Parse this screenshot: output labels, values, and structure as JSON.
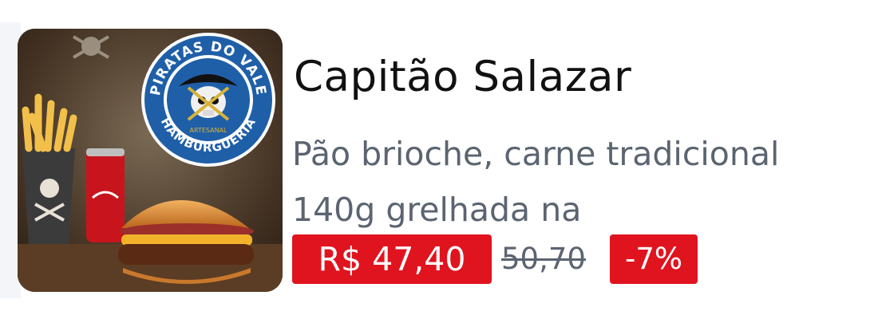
{
  "product": {
    "name": "Capitão Salazar",
    "description": "Pão brioche, carne tradicional 140g grelhada na",
    "price": "R$ 47,40",
    "old_price": "50,70",
    "discount": "-7%"
  },
  "logo": {
    "ring_text_top": "PIRATAS DO VALE",
    "ring_text_bottom": "HAMBURGUERIA",
    "inner_text": "ARTESANAL",
    "icon": "pirate-skull-logo"
  },
  "colors": {
    "price_badge": "#e0141e",
    "title": "#111111",
    "description": "#5b6470",
    "logo_ring": "#1f5fa8"
  }
}
